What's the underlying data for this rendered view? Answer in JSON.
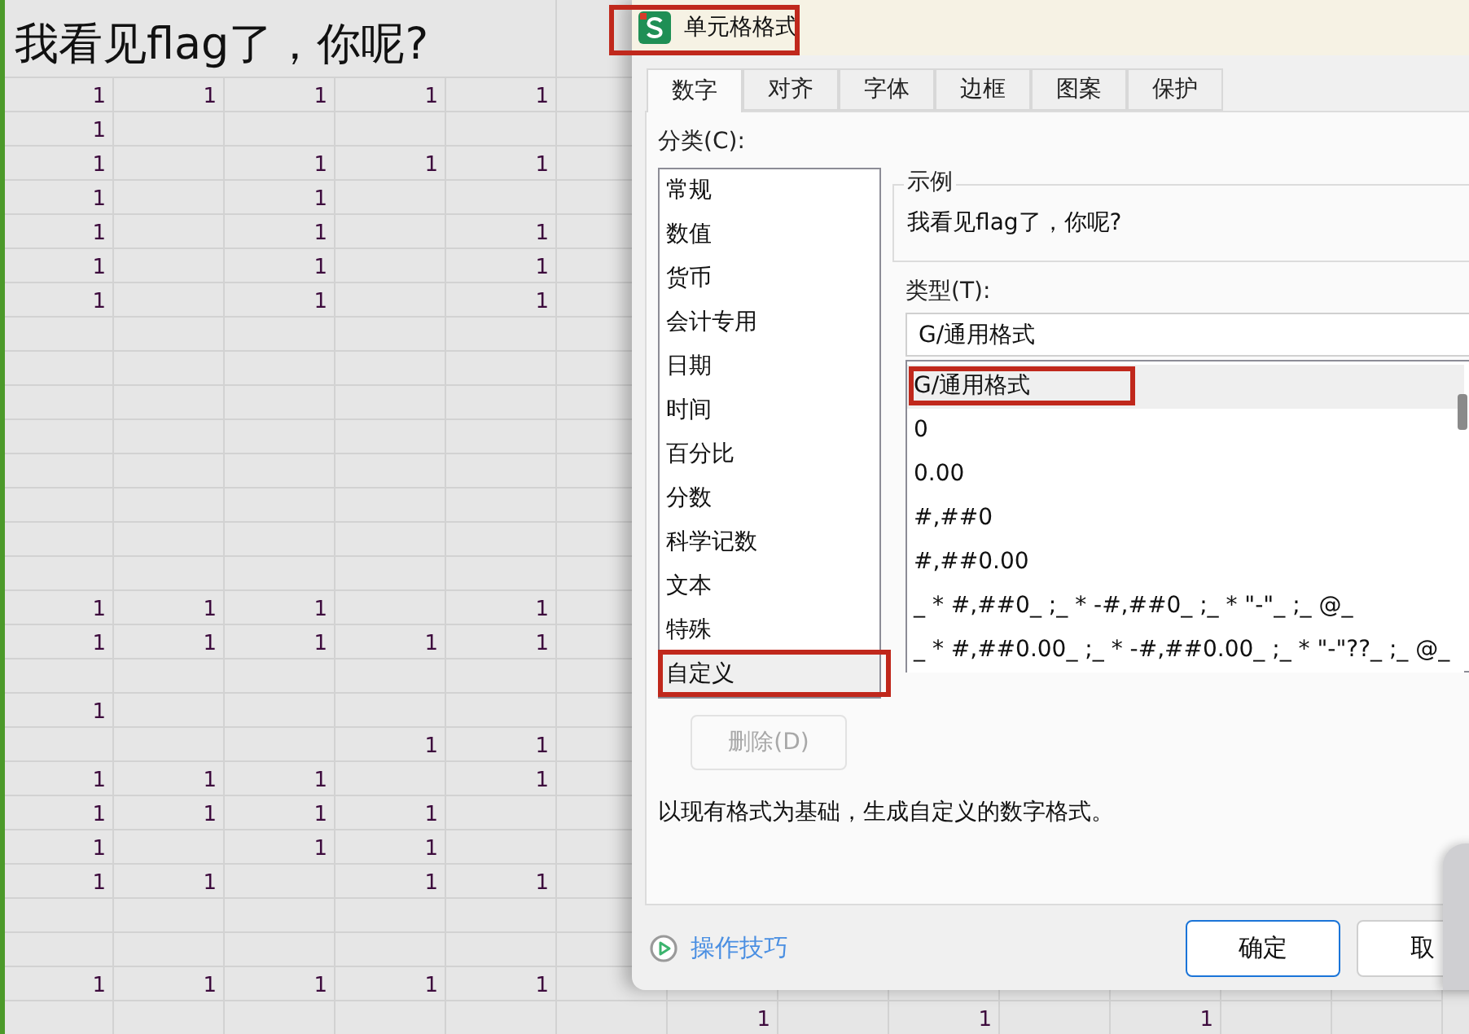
{
  "sheet": {
    "title_cell": "我看见flag了，你呢?",
    "rows": [
      [
        "1",
        "1",
        "1",
        "1",
        "1"
      ],
      [
        "1"
      ],
      [
        "1",
        null,
        "1",
        "1",
        "1"
      ],
      [
        "1",
        null,
        "1"
      ],
      [
        "1",
        null,
        "1",
        null,
        "1"
      ],
      [
        "1",
        null,
        "1",
        null,
        "1"
      ],
      [
        "1",
        null,
        "1",
        null,
        "1"
      ],
      [
        null
      ],
      [
        null
      ],
      [
        null
      ],
      [
        null
      ],
      [
        null
      ],
      [
        null
      ],
      [
        null
      ],
      [
        null
      ],
      [
        "1",
        "1",
        "1",
        null,
        "1"
      ],
      [
        "1",
        "1",
        "1",
        "1",
        "1"
      ],
      [
        null
      ],
      [
        "1"
      ],
      [
        null,
        null,
        null,
        "1",
        "1"
      ],
      [
        "1",
        "1",
        "1",
        null,
        "1"
      ],
      [
        "1",
        "1",
        "1",
        "1"
      ],
      [
        "1",
        null,
        "1",
        "1"
      ],
      [
        "1",
        "1",
        null,
        "1",
        "1"
      ],
      [
        null
      ],
      [
        null
      ],
      [
        "1",
        "1",
        "1",
        "1",
        "1"
      ],
      [
        null,
        null,
        null,
        null,
        null,
        null,
        "1",
        null,
        "1",
        null,
        "1"
      ]
    ]
  },
  "dialog": {
    "title": "单元格格式",
    "title_annotated": true,
    "tabs": [
      {
        "label": "数字",
        "selected": true
      },
      {
        "label": "对齐",
        "selected": false
      },
      {
        "label": "字体",
        "selected": false
      },
      {
        "label": "边框",
        "selected": false
      },
      {
        "label": "图案",
        "selected": false
      },
      {
        "label": "保护",
        "selected": false
      }
    ],
    "category_label": "分类(C):",
    "categories": [
      {
        "label": "常规",
        "selected": false,
        "annotated": false
      },
      {
        "label": "数值",
        "selected": false,
        "annotated": false
      },
      {
        "label": "货币",
        "selected": false,
        "annotated": false
      },
      {
        "label": "会计专用",
        "selected": false,
        "annotated": false
      },
      {
        "label": "日期",
        "selected": false,
        "annotated": false
      },
      {
        "label": "时间",
        "selected": false,
        "annotated": false
      },
      {
        "label": "百分比",
        "selected": false,
        "annotated": false
      },
      {
        "label": "分数",
        "selected": false,
        "annotated": false
      },
      {
        "label": "科学记数",
        "selected": false,
        "annotated": false
      },
      {
        "label": "文本",
        "selected": false,
        "annotated": false
      },
      {
        "label": "特殊",
        "selected": false,
        "annotated": false
      },
      {
        "label": "自定义",
        "selected": true,
        "annotated": true
      }
    ],
    "sample": {
      "legend": "示例",
      "text": "我看见flag了，你呢?"
    },
    "type_label": "类型(T):",
    "type_value": "G/通用格式",
    "types": [
      {
        "label": "G/通用格式",
        "selected": true,
        "annotated": true
      },
      {
        "label": "0",
        "selected": false,
        "annotated": false
      },
      {
        "label": "0.00",
        "selected": false,
        "annotated": false
      },
      {
        "label": "#,##0",
        "selected": false,
        "annotated": false
      },
      {
        "label": "#,##0.00",
        "selected": false,
        "annotated": false
      },
      {
        "label": "_ * #,##0_ ;_ * -#,##0_ ;_ * \"-\"_ ;_ @_",
        "selected": false,
        "annotated": false
      },
      {
        "label": "_ * #,##0.00_ ;_ * -#,##0.00_ ;_ * \"-\"??_ ;_ @_",
        "selected": false,
        "annotated": false
      }
    ],
    "delete_button": {
      "label": "删除(D)",
      "disabled": true
    },
    "description": "以现有格式为基础，生成自定义的数字格式。",
    "tips_link": "操作技巧",
    "buttons": [
      {
        "label": "确定",
        "kind": "primary"
      },
      {
        "label": "取",
        "kind": "secondary"
      }
    ]
  }
}
